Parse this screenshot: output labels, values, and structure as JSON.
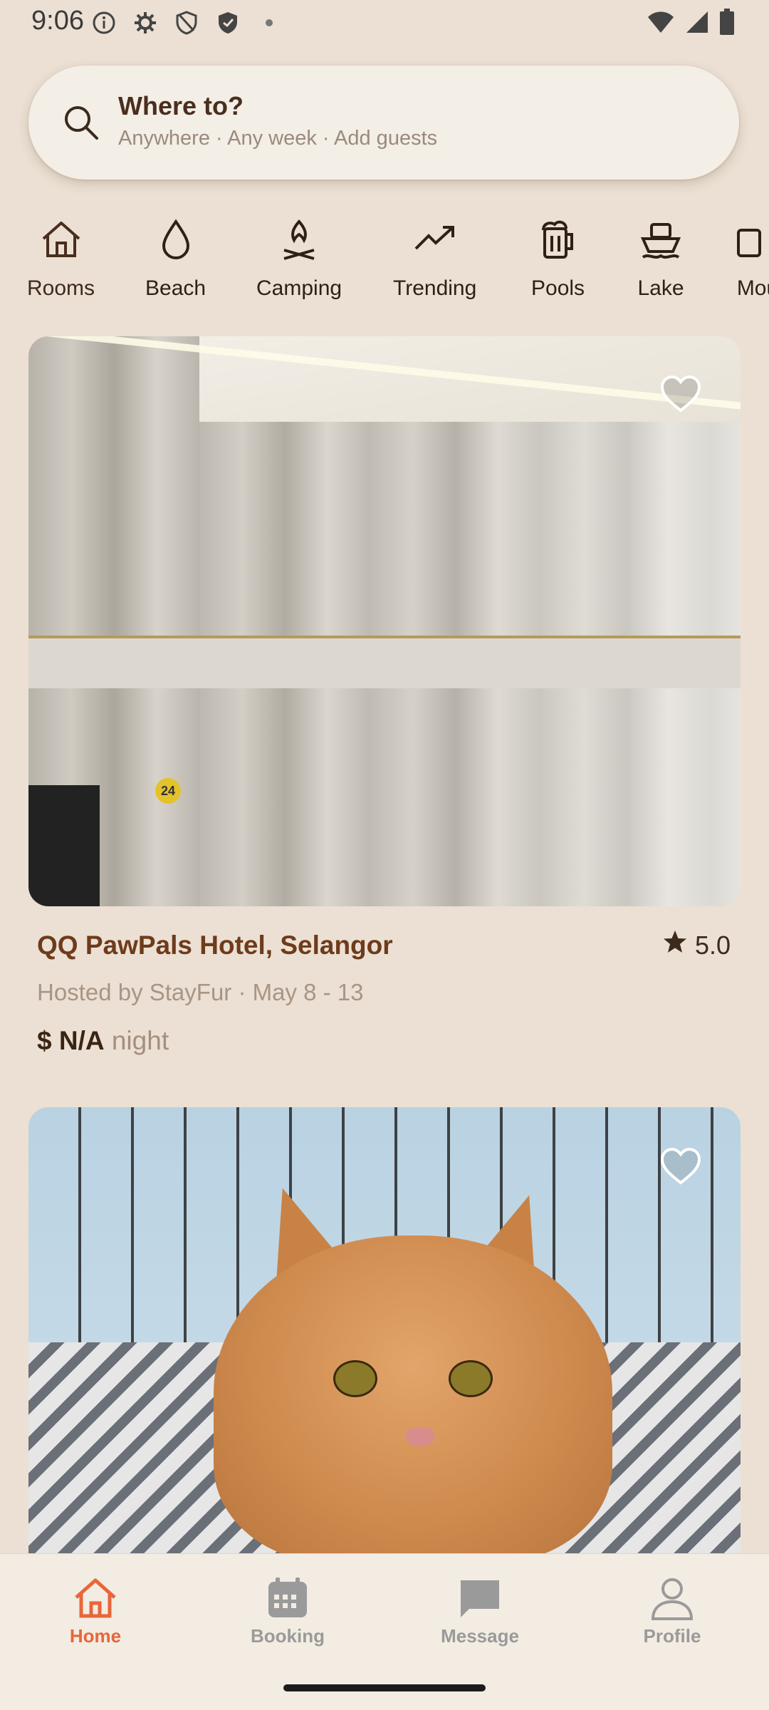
{
  "status_bar": {
    "time": "9:06"
  },
  "search": {
    "title": "Where to?",
    "subtitle": "Anywhere · Any week · Add guests"
  },
  "categories": [
    {
      "label": "Rooms",
      "icon": "house-icon",
      "active": true
    },
    {
      "label": "Beach",
      "icon": "water-drop-icon"
    },
    {
      "label": "Camping",
      "icon": "campfire-icon"
    },
    {
      "label": "Trending",
      "icon": "trending-up-icon"
    },
    {
      "label": "Pools",
      "icon": "beer-mug-icon"
    },
    {
      "label": "Lake",
      "icon": "boat-icon"
    },
    {
      "label": "Mou",
      "icon": "mountain-icon"
    }
  ],
  "listings": [
    {
      "title": "QQ PawPals Hotel, Selangor",
      "rating": "5.0",
      "host_dates": "Hosted by StayFur · May 8 - 13",
      "price": "$ N/A",
      "price_unit": "night",
      "image": "hotel-room-cages"
    },
    {
      "image": "orange-cat-in-crate"
    }
  ],
  "cage_number": "24",
  "nav": {
    "items": [
      {
        "label": "Home",
        "icon": "home-icon",
        "active": true
      },
      {
        "label": "Booking",
        "icon": "calendar-icon"
      },
      {
        "label": "Message",
        "icon": "chat-icon"
      },
      {
        "label": "Profile",
        "icon": "person-icon"
      }
    ]
  },
  "colors": {
    "accent": "#e8663a",
    "title_brown": "#6e3b1b",
    "background": "#ebe0d3"
  }
}
